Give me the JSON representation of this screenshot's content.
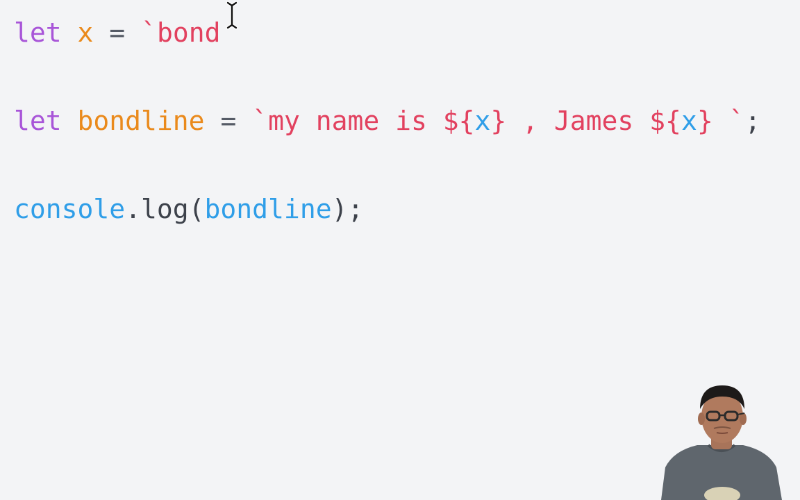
{
  "editor": {
    "lines": [
      {
        "tokens": [
          {
            "text": "let",
            "kind": "keyword"
          },
          {
            "text": " ",
            "kind": "space"
          },
          {
            "text": "x",
            "kind": "var"
          },
          {
            "text": " = ",
            "kind": "op"
          },
          {
            "text": "`bond",
            "kind": "str"
          }
        ]
      },
      {
        "tokens": [
          {
            "text": "let",
            "kind": "keyword"
          },
          {
            "text": " ",
            "kind": "space"
          },
          {
            "text": "bondline",
            "kind": "var"
          },
          {
            "text": " = ",
            "kind": "op"
          },
          {
            "text": "`my name is ${",
            "kind": "str"
          },
          {
            "text": "x",
            "kind": "fn"
          },
          {
            "text": "} , James ${",
            "kind": "str"
          },
          {
            "text": "x",
            "kind": "fn"
          },
          {
            "text": "} `",
            "kind": "str"
          },
          {
            "text": ";",
            "kind": "punc"
          }
        ]
      },
      {
        "tokens": [
          {
            "text": "console",
            "kind": "fn"
          },
          {
            "text": ".log(",
            "kind": "punc"
          },
          {
            "text": "bondline",
            "kind": "fn"
          },
          {
            "text": ");",
            "kind": "punc"
          }
        ]
      }
    ]
  },
  "colors": {
    "background": "#f3f4f6",
    "keyword": "#a855d8",
    "variable": "#ea8a1c",
    "string": "#e2415f",
    "function": "#2f9ee8",
    "punctuation": "#3d424b"
  },
  "icons": {
    "text_cursor": "i-beam-cursor-icon",
    "webcam": "presenter-webcam-overlay"
  }
}
